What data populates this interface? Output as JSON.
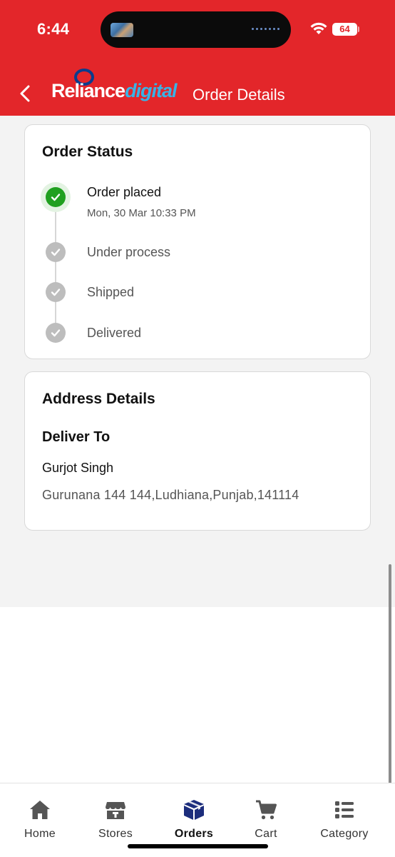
{
  "status_bar": {
    "time": "6:44",
    "battery": "64"
  },
  "app_bar": {
    "logo_reliance": "Reliance",
    "logo_digital": "digital",
    "title": "Order Details",
    "back_icon": "chevron-left-icon"
  },
  "order_status": {
    "title": "Order Status",
    "steps": [
      {
        "label": "Order placed",
        "date": "Mon, 30 Mar 10:33 PM",
        "state": "done",
        "icon": "check-circle-icon"
      },
      {
        "label": "Under process",
        "state": "pending",
        "icon": "check-circle-icon"
      },
      {
        "label": "Shipped",
        "state": "pending",
        "icon": "check-circle-icon"
      },
      {
        "label": "Delivered",
        "state": "pending",
        "icon": "check-circle-icon"
      }
    ]
  },
  "address": {
    "title": "Address Details",
    "deliver_to_label": "Deliver To",
    "name": "Gurjot Singh",
    "line": "Gurunana 144 144,Ludhiana,Punjab,141114"
  },
  "bottom_nav": {
    "items": [
      {
        "label": "Home",
        "icon": "home-icon"
      },
      {
        "label": "Stores",
        "icon": "store-icon"
      },
      {
        "label": "Orders",
        "icon": "package-icon",
        "active": true
      },
      {
        "label": "Cart",
        "icon": "cart-icon"
      },
      {
        "label": "Category",
        "icon": "category-list-icon"
      }
    ]
  },
  "colors": {
    "brand_red": "#e3262a",
    "success_green": "#20a020",
    "active_nav_blue": "#1c2d7c",
    "pending_gray": "#bdbdbd"
  }
}
